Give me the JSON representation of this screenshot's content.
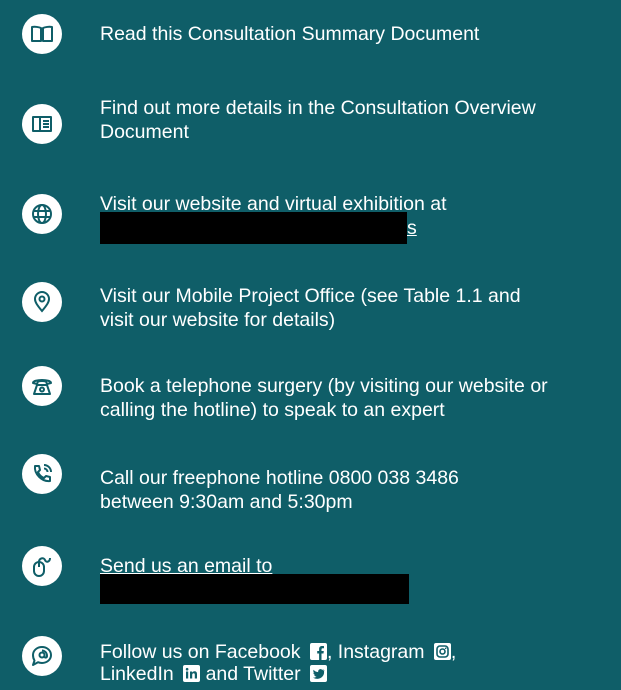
{
  "items": [
    {
      "icon": "open-book-icon",
      "text": "Read this Consultation Summary Document"
    },
    {
      "icon": "document-book-icon",
      "line1": "Find out more details in the Consultation Overview",
      "line2": "Document"
    },
    {
      "icon": "globe-icon",
      "line1": "Visit our website and virtual exhibition at",
      "link_tail": "s"
    },
    {
      "icon": "location-pin-icon",
      "line1": "Visit our Mobile Project Office (see Table 1.1 and",
      "line2": "visit our website for details)"
    },
    {
      "icon": "telephone-icon",
      "line1": "Book a telephone surgery (by visiting our website or",
      "line2": "calling the hotline) to speak to an expert"
    },
    {
      "icon": "phone-call-icon",
      "line1_pre": "Call our freephone hotline ",
      "phone": "0800 038 3486",
      "line2": "between 9:30am and 5:30pm"
    },
    {
      "icon": "mouse-icon",
      "line1": "Send us an email to"
    },
    {
      "icon": "chat-at-icon",
      "line1_a": "Follow us on Facebook",
      "line1_b": ", Instagram",
      "line1_c": ",",
      "line2_a": "LinkedIn",
      "line2_b": " and Twitter"
    }
  ],
  "colors": {
    "background": "#0f5e68",
    "icon_fg": "#0f5e68",
    "text": "#ffffff"
  }
}
